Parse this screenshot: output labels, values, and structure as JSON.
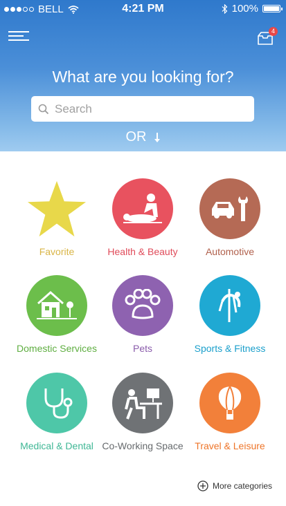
{
  "status_bar": {
    "carrier": "BELL",
    "time": "4:21 PM",
    "battery": "100%"
  },
  "header": {
    "inbox_count": "4",
    "question": "What are you looking for?"
  },
  "search": {
    "placeholder": "Search"
  },
  "or_label": "OR",
  "categories": [
    {
      "label": "Favorite",
      "color": "#e8c84a",
      "icon": "star-icon"
    },
    {
      "label": "Health & Beauty",
      "color": "#e8525f",
      "icon": "massage-icon"
    },
    {
      "label": "Automotive",
      "color": "#b56a55",
      "icon": "car-wrench-icon"
    },
    {
      "label": "Domestic Services",
      "color": "#6cbe4b",
      "icon": "house-icon"
    },
    {
      "label": "Pets",
      "color": "#8e62b0",
      "icon": "paw-icon"
    },
    {
      "label": "Sports & Fitness",
      "color": "#1fa9d3",
      "icon": "pole-fitness-icon"
    },
    {
      "label": "Medical & Dental",
      "color": "#4ec7a8",
      "icon": "stethoscope-icon"
    },
    {
      "label": "Co-Working Space",
      "color": "#6f7275",
      "icon": "desk-worker-icon"
    },
    {
      "label": "Travel & Leisure",
      "color": "#f2803a",
      "icon": "hot-air-balloon-icon"
    }
  ],
  "more_categories": "More categories"
}
